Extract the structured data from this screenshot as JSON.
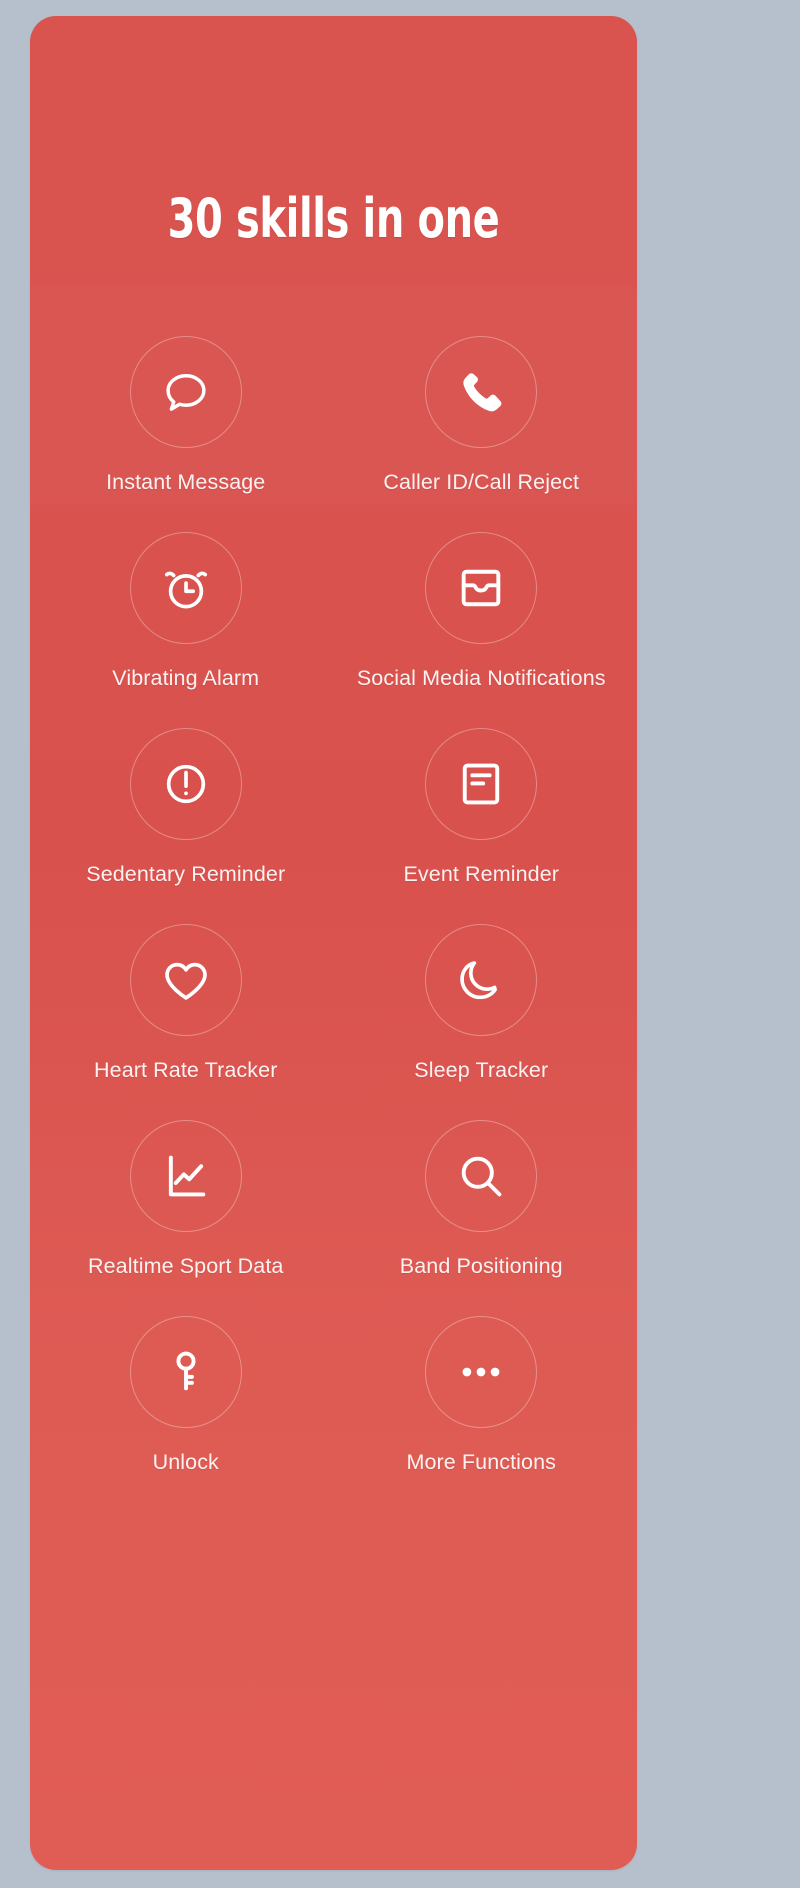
{
  "theme": {
    "page_background": "#b6c0cd",
    "card_background": "#d9534f",
    "icon_color": "#ffffff",
    "label_color": "#fdf2f1",
    "circle_border_color": "rgba(255,255,255,0.32)"
  },
  "headline": "30 skills in one",
  "features": [
    {
      "label": "Instant Message",
      "icon": "speech-bubble-icon"
    },
    {
      "label": "Caller ID/Call Reject",
      "icon": "phone-handset-icon"
    },
    {
      "label": "Vibrating Alarm",
      "icon": "alarm-clock-icon"
    },
    {
      "label": "Social Media Notifications",
      "icon": "inbox-tray-icon"
    },
    {
      "label": "Sedentary Reminder",
      "icon": "exclamation-circle-icon"
    },
    {
      "label": "Event Reminder",
      "icon": "note-document-icon"
    },
    {
      "label": "Heart Rate Tracker",
      "icon": "heart-icon"
    },
    {
      "label": "Sleep Tracker",
      "icon": "crescent-moon-icon"
    },
    {
      "label": "Realtime Sport Data",
      "icon": "line-chart-icon"
    },
    {
      "label": "Band Positioning",
      "icon": "magnifier-search-icon"
    },
    {
      "label": "Unlock",
      "icon": "key-icon"
    },
    {
      "label": "More Functions",
      "icon": "ellipsis-icon"
    }
  ]
}
